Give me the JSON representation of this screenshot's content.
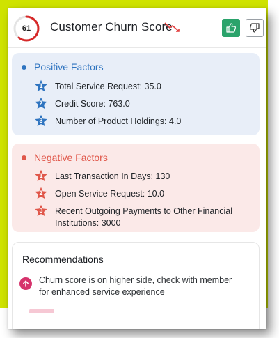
{
  "header": {
    "score": "61",
    "score_fraction": 0.61,
    "title": "Customer Churn Score",
    "trend_icon": "trend-down-icon",
    "like_icon": "thumbs-up-icon",
    "dislike_icon": "thumbs-down-icon"
  },
  "positive": {
    "heading": "Positive Factors",
    "color": "#2f74c0",
    "items": [
      {
        "rank": "1",
        "text": "Total Service Request: 35.0"
      },
      {
        "rank": "2",
        "text": "Credit Score: 763.0"
      },
      {
        "rank": "3",
        "text": "Number of Product Holdings: 4.0"
      }
    ]
  },
  "negative": {
    "heading": "Negative Factors",
    "color": "#e0574a",
    "items": [
      {
        "rank": "1",
        "text": "Last Transaction In Days: 130"
      },
      {
        "rank": "2",
        "text": "Open Service Request: 10.0"
      },
      {
        "rank": "3",
        "text": "Recent Outgoing Payments to Other Financial Institutions: 3000"
      }
    ]
  },
  "recommendations": {
    "title": "Recommendations",
    "items": [
      {
        "icon": "arrow-up-icon",
        "text": "Churn score is on higher side, check with member for enhanced service experience"
      }
    ]
  }
}
